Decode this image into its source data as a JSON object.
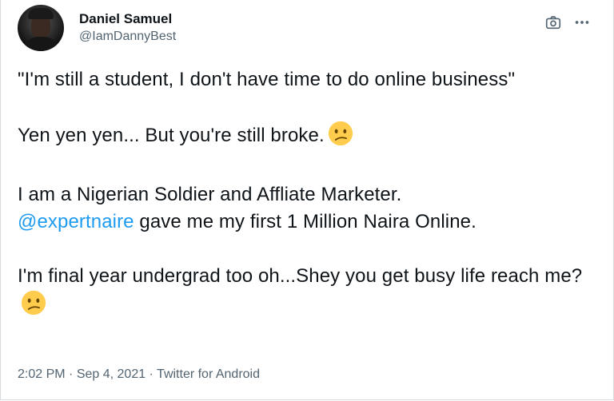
{
  "user": {
    "display_name": "Daniel Samuel",
    "handle": "@IamDannyBest"
  },
  "actions": {
    "camera_icon": "camera-icon",
    "more_icon": "more-dots-icon"
  },
  "tweet": {
    "p1": "\"I'm still a student, I don't have time to do online business\"",
    "p2": "Yen yen yen... But you're still broke.",
    "p3_line1": "I am a Nigerian Soldier and Affliate Marketer.",
    "p3_mention": "@expertnaire",
    "p3_rest": " gave me my first 1 Million Naira Online.",
    "p4": "I'm final year undergrad too oh...Shey you get busy life reach me?",
    "emoji_name": "confused-face-emoji"
  },
  "meta": {
    "time": "2:02 PM",
    "sep1": " · ",
    "date": "Sep 4, 2021",
    "sep2": " · ",
    "source": "Twitter for Android"
  },
  "colors": {
    "text": "#0f1419",
    "secondary": "#536471",
    "link": "#1d9bf0",
    "emoji_face": "#ffcc4d"
  }
}
